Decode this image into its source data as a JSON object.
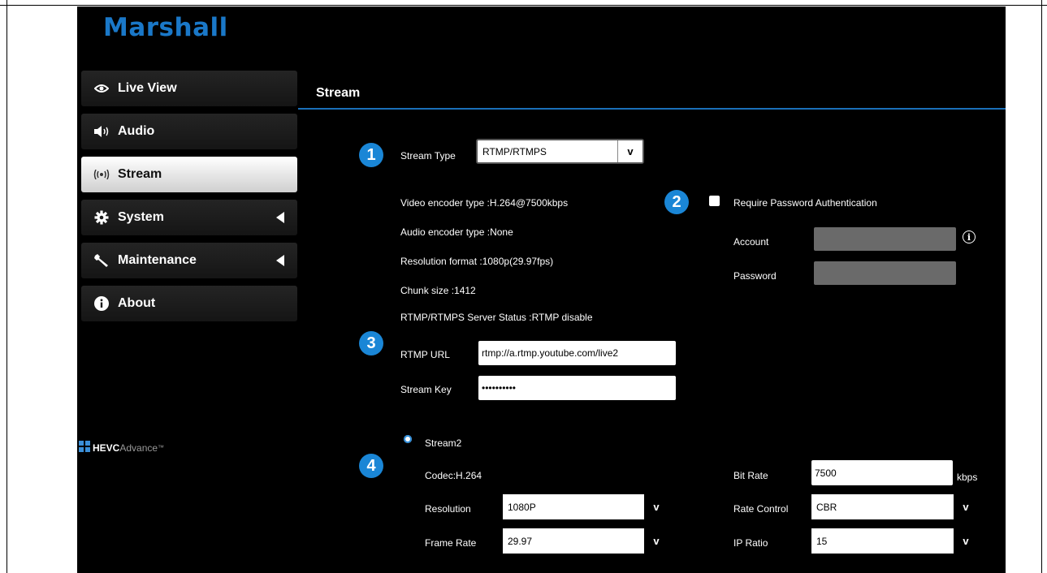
{
  "brand": {
    "logo_text": "Marshall",
    "logo_color": "#1a78c8",
    "accent_color": "#1a86d6"
  },
  "sidebar": {
    "items": [
      {
        "label": "Live View",
        "icon": "eye-icon",
        "active": false,
        "has_arrow": false
      },
      {
        "label": "Audio",
        "icon": "speaker-icon",
        "active": false,
        "has_arrow": false
      },
      {
        "label": "Stream",
        "icon": "broadcast-icon",
        "active": true,
        "has_arrow": false
      },
      {
        "label": "System",
        "icon": "gear-icon",
        "active": false,
        "has_arrow": true
      },
      {
        "label": "Maintenance",
        "icon": "wrench-icon",
        "active": false,
        "has_arrow": true
      },
      {
        "label": "About",
        "icon": "info-icon",
        "active": false,
        "has_arrow": false
      }
    ],
    "hevc": {
      "mark": "HE\nVC",
      "brand": "HEVC",
      "suffix": "Advance",
      "tm": "™"
    }
  },
  "main": {
    "title": "Stream",
    "badges": [
      "1",
      "2",
      "3",
      "4"
    ],
    "stream_type": {
      "label": "Stream Type",
      "value": "RTMP/RTMPS",
      "chevron": "v"
    },
    "info": {
      "video_encoder": "Video encoder type :H.264@7500kbps",
      "audio_encoder": "Audio encoder type :None",
      "resolution_format": "Resolution format :1080p(29.97fps)",
      "chunk_size": "Chunk size :1412",
      "server_status": "RTMP/RTMPS Server Status :RTMP disable"
    },
    "auth": {
      "checkbox_label": "Require Password Authentication",
      "account_label": "Account",
      "account_value": "",
      "password_label": "Password",
      "password_value": "",
      "info_symbol": "i"
    },
    "rtmp": {
      "url_label": "RTMP URL",
      "url_value": "rtmp://a.rtmp.youtube.com/live2",
      "key_label": "Stream Key",
      "key_value": "••••••••••"
    },
    "stream2": {
      "label": "Stream2",
      "codec": "Codec:H.264",
      "resolution_label": "Resolution",
      "resolution_value": "1080P",
      "frame_rate_label": "Frame Rate",
      "frame_rate_value": "29.97",
      "bit_rate_label": "Bit Rate",
      "bit_rate_value": "7500",
      "bit_rate_unit": "kbps",
      "rate_control_label": "Rate Control",
      "rate_control_value": "CBR",
      "ip_ratio_label": "IP Ratio",
      "ip_ratio_value": "15",
      "chevron": "v"
    }
  }
}
